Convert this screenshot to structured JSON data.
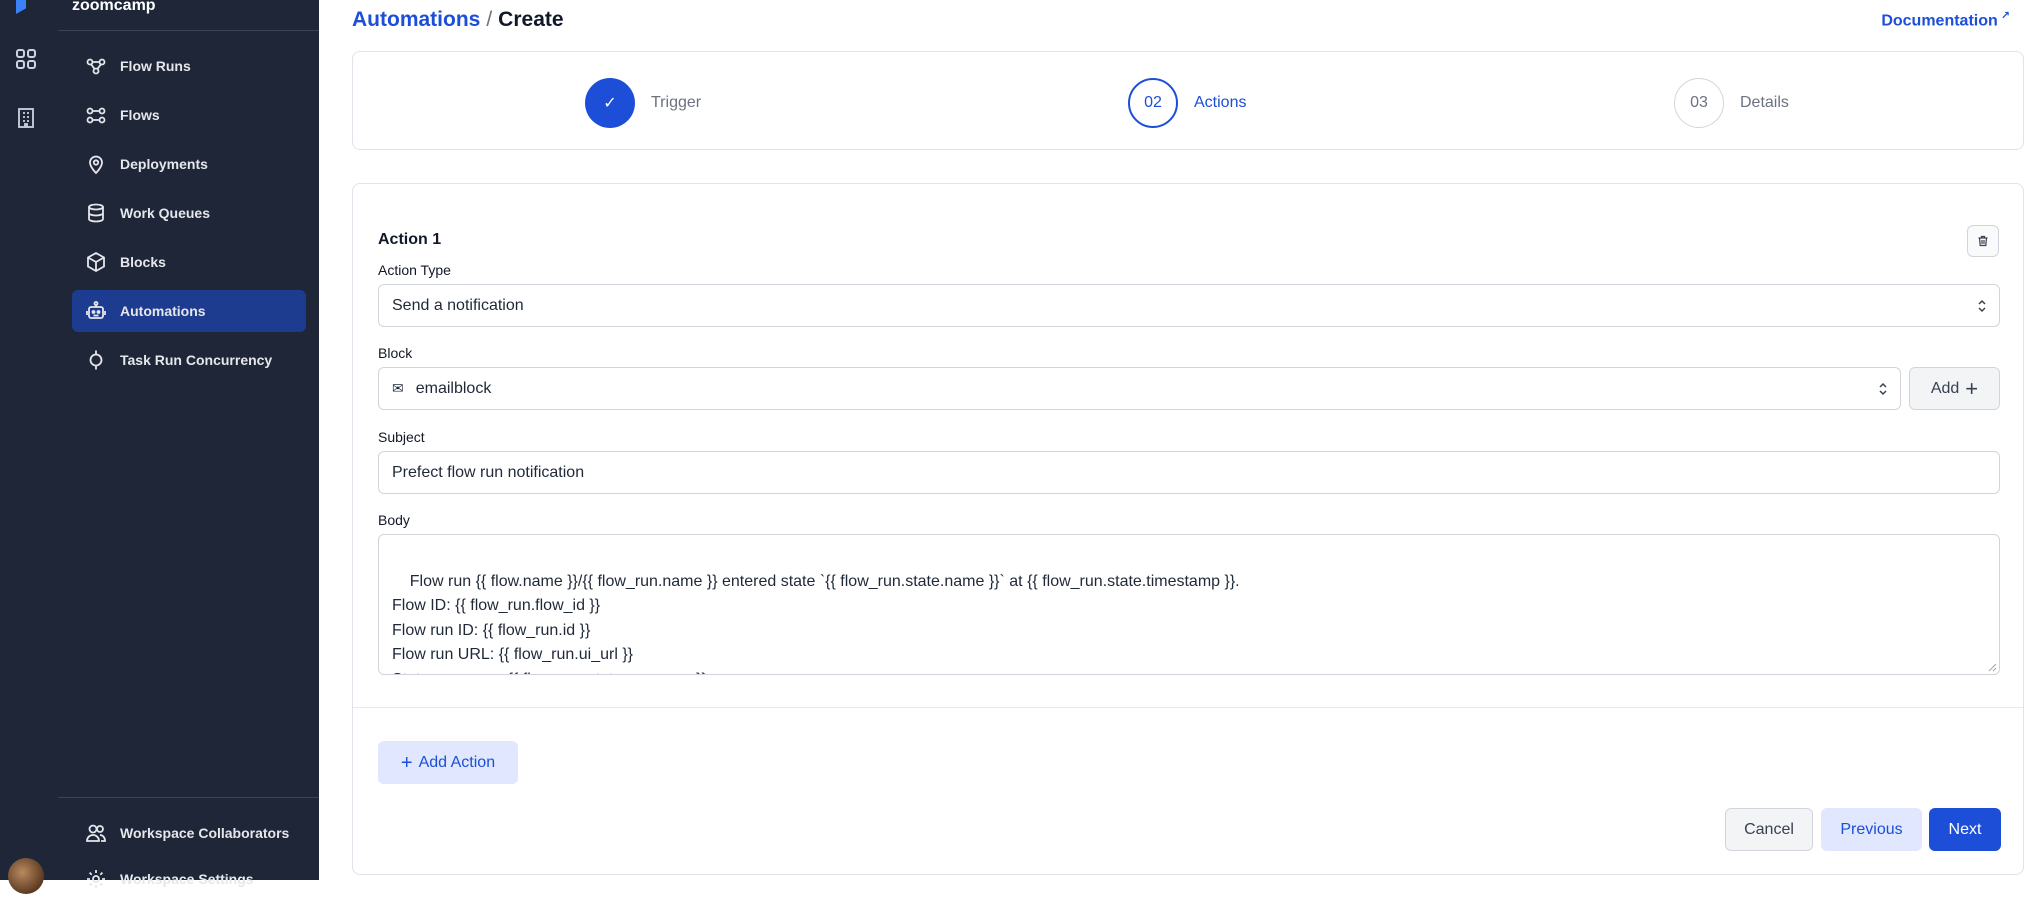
{
  "sidebar": {
    "workspace": "zoomcamp",
    "items": [
      {
        "label": "Flow Runs",
        "icon": "flow-runs-icon"
      },
      {
        "label": "Flows",
        "icon": "flows-icon"
      },
      {
        "label": "Deployments",
        "icon": "deployments-icon"
      },
      {
        "label": "Work Queues",
        "icon": "work-queues-icon"
      },
      {
        "label": "Blocks",
        "icon": "blocks-icon"
      },
      {
        "label": "Automations",
        "icon": "automations-icon",
        "active": true
      },
      {
        "label": "Task Run Concurrency",
        "icon": "task-run-concurrency-icon"
      }
    ],
    "bottom_items": [
      {
        "label": "Workspace Collaborators",
        "icon": "collaborators-icon"
      },
      {
        "label": "Workspace Settings",
        "icon": "settings-icon"
      }
    ]
  },
  "header": {
    "crumb_link": "Automations",
    "separator": "/",
    "crumb_current": "Create",
    "documentation": "Documentation"
  },
  "steps": [
    {
      "number": "✓",
      "label": "Trigger",
      "state": "done"
    },
    {
      "number": "02",
      "label": "Actions",
      "state": "current"
    },
    {
      "number": "03",
      "label": "Details",
      "state": "todo"
    }
  ],
  "form": {
    "action_title": "Action 1",
    "action_type_label": "Action Type",
    "action_type_value": "Send a notification",
    "block_label": "Block",
    "block_value": "emailblock",
    "add_label": "Add",
    "subject_label": "Subject",
    "subject_value": "Prefect flow run notification",
    "body_label": "Body",
    "body_value": "Flow run {{ flow.name }}/{{ flow_run.name }} entered state `{{ flow_run.state.name }}` at {{ flow_run.state.timestamp }}.\nFlow ID: {{ flow_run.flow_id }}\nFlow run ID: {{ flow_run.id }}\nFlow run URL: {{ flow_run.ui_url }}\nState message: {{ flow_run.state.message }}",
    "add_action_label": "Add Action"
  },
  "footer": {
    "cancel": "Cancel",
    "previous": "Previous",
    "next": "Next"
  },
  "colors": {
    "sidebar_bg": "#1e2638",
    "active_nav": "#1d3b8f",
    "accent": "#1d4ed8",
    "accent_soft": "#e0e7ff"
  }
}
